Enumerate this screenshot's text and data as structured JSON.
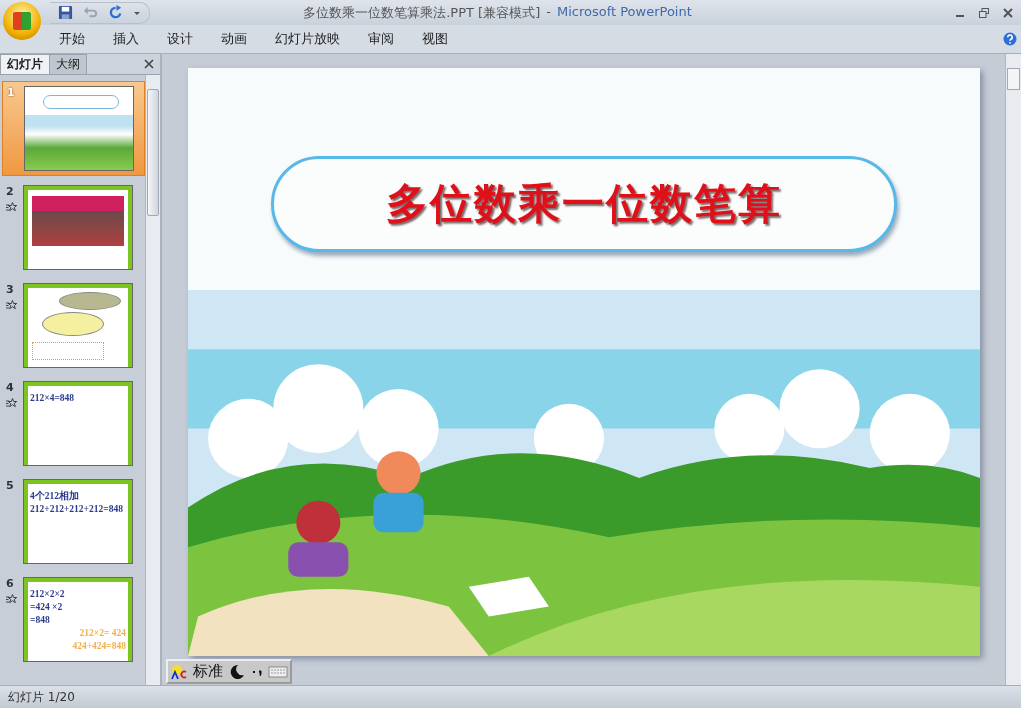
{
  "window": {
    "title": "多位数乘一位数笔算乘法.PPT [兼容模式]",
    "separator": "-",
    "app": "Microsoft PowerPoint"
  },
  "ribbon_tabs": [
    {
      "label": "开始"
    },
    {
      "label": "插入"
    },
    {
      "label": "设计"
    },
    {
      "label": "动画"
    },
    {
      "label": "幻灯片放映"
    },
    {
      "label": "审阅"
    },
    {
      "label": "视图"
    }
  ],
  "pane_tabs": [
    {
      "label": "幻灯片",
      "selected": true
    },
    {
      "label": "大纲",
      "selected": false
    }
  ],
  "slides": [
    {
      "number": "1",
      "selected": true,
      "animated": false,
      "kind": "title"
    },
    {
      "number": "2",
      "selected": false,
      "animated": true,
      "kind": "photo"
    },
    {
      "number": "3",
      "selected": false,
      "animated": true,
      "kind": "dialog"
    },
    {
      "number": "4",
      "selected": false,
      "animated": true,
      "kind": "text",
      "lines": [
        {
          "text": "212×4=848",
          "color": "#2b3a8c"
        }
      ]
    },
    {
      "number": "5",
      "selected": false,
      "animated": false,
      "kind": "text",
      "lines": [
        {
          "text": "4个212相加",
          "color": "#2b3a8c"
        },
        {
          "text": "212+212+212+212=848",
          "color": "#2b3a8c"
        }
      ]
    },
    {
      "number": "6",
      "selected": false,
      "animated": true,
      "kind": "text",
      "lines": [
        {
          "text": "212×2×2",
          "color": "#2b3a8c"
        },
        {
          "text": "=424 ×2",
          "color": "#2b3a8c"
        },
        {
          "text": "=848",
          "color": "#2b3a8c"
        },
        {
          "text": "212×2= 424",
          "color": "#f0b050"
        },
        {
          "text": "424+424=848",
          "color": "#f0b050"
        }
      ]
    }
  ],
  "slide": {
    "title": "多位数乘一位数笔算"
  },
  "ime_toolbar": {
    "mode": "标准"
  },
  "status_bar": {
    "slide_position": "幻灯片 1/20"
  }
}
